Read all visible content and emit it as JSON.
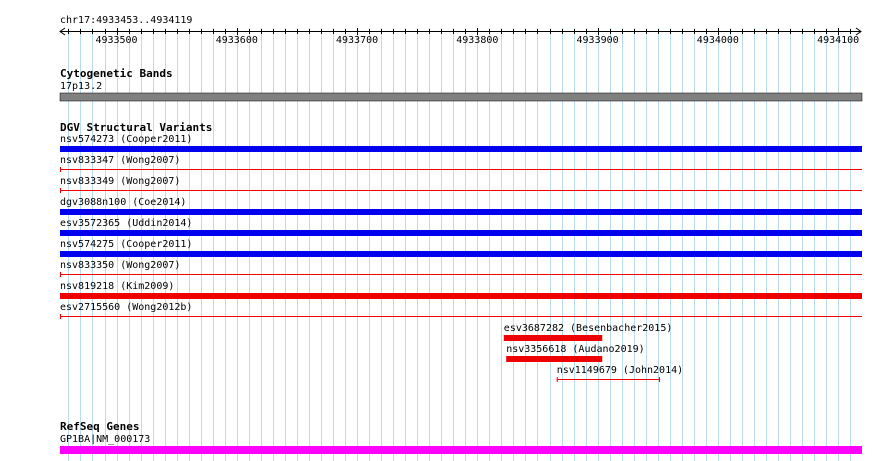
{
  "browser": {
    "region_label": "chr17:4933453..4934119",
    "range": [
      4933453,
      4934119
    ],
    "ruler_ticks": [
      "4933500",
      "4933600",
      "4933700",
      "4933800",
      "4933900",
      "4934000",
      "4934100"
    ],
    "tracks": {
      "cytoband": {
        "title": "Cytogenetic Bands",
        "band_label": "17p13.2",
        "color": "#808080"
      },
      "dgv": {
        "title": "DGV Structural Variants",
        "colors": {
          "blue": "#0000ee",
          "red": "#ee0000"
        },
        "features": [
          {
            "label": "nsv574273 (Cooper2011)",
            "color": "blue",
            "start": 4933453,
            "end": 4934119
          },
          {
            "label": "nsv833347 (Wong2007)",
            "color": "red",
            "start": 4933453,
            "end": 4934119
          },
          {
            "label": "nsv833349 (Wong2007)",
            "color": "red",
            "start": 4933453,
            "end": 4934119
          },
          {
            "label": "dgv3088n100 (Coe2014)",
            "color": "blue",
            "start": 4933453,
            "end": 4934119
          },
          {
            "label": "esv3572365 (Uddin2014)",
            "color": "blue",
            "start": 4933453,
            "end": 4934119
          },
          {
            "label": "nsv574275 (Cooper2011)",
            "color": "blue",
            "start": 4933453,
            "end": 4934119
          },
          {
            "label": "nsv833350 (Wong2007)",
            "color": "red",
            "start": 4933453,
            "end": 4934119
          },
          {
            "label": "nsv819218 (Kim2009)",
            "color": "red",
            "start": 4933453,
            "end": 4934119
          },
          {
            "label": "esv2715560 (Wong2012b)",
            "color": "red",
            "start": 4933453,
            "end": 4934119
          },
          {
            "label": "esv3687282 (Besenbacher2015)",
            "color": "red",
            "start": 4933822,
            "end": 4933903
          },
          {
            "label": "nsv3356618 (Audano2019)",
            "color": "red",
            "start": 4933824,
            "end": 4933903
          },
          {
            "label": "nsv1149679 (John2014)",
            "color": "red",
            "start": 4933866,
            "end": 4933951
          }
        ]
      },
      "refseq": {
        "title": "RefSeq Genes",
        "gene_label": "GP1BA|NM_000173",
        "color": "#ff00ff"
      }
    }
  }
}
